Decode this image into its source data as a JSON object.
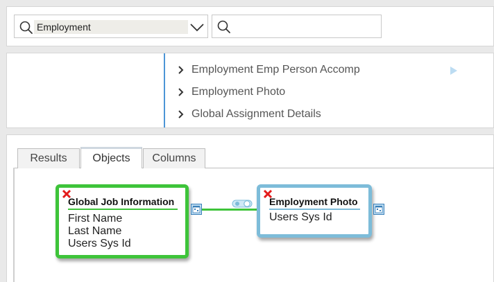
{
  "search": {
    "query": "Employment",
    "second_placeholder": ""
  },
  "results_list": {
    "items": [
      {
        "label": "Employment Emp Person Accomp"
      },
      {
        "label": "Employment Photo"
      },
      {
        "label": "Global Assignment Details"
      }
    ]
  },
  "tabs": [
    {
      "label": "Results"
    },
    {
      "label": "Objects",
      "active": true
    },
    {
      "label": "Columns"
    }
  ],
  "objects": {
    "primary": {
      "title": "Global Job Information",
      "fields": [
        "First Name",
        "Last Name",
        "Users Sys Id"
      ],
      "border_color": "#3ec43a"
    },
    "secondary": {
      "title": "Employment Photo",
      "fields": [
        "Users Sys Id"
      ],
      "border_color": "#7dbcd9"
    }
  },
  "icons": {
    "search": "search-icon",
    "dropdown": "chevron-down-icon",
    "expand": "chevron-right-icon",
    "remove": "close-icon",
    "properties": "calendar-icon",
    "join": "toggle-icon",
    "scroll": "play-right-icon"
  },
  "colors": {
    "accent_blue": "#4c95d6",
    "primary_green": "#3ec43a",
    "secondary_blue": "#7dbcd9",
    "remove_red": "#e31b1b"
  }
}
